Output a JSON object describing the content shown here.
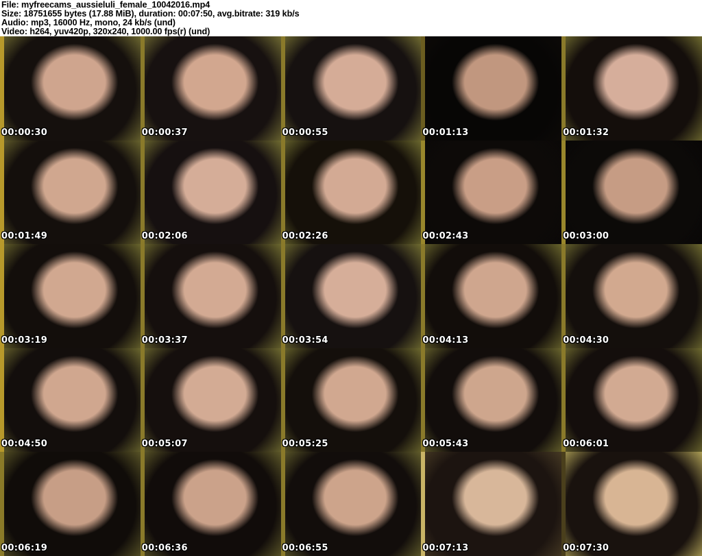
{
  "header": {
    "background": "#ffffff",
    "text_color": "#000000",
    "file_line": "File: myfreecams_aussieluli_female_10042016.mp4",
    "size_line": "Size: 18751655 bytes (17.88 MiB), duration: 00:07:50, avg.bitrate: 319 kb/s",
    "audio_line": "Audio: mp3, 16000 Hz, mono, 24 kb/s (und)",
    "video_line": "Video: h264, yuv420p, 320x240, 1000.00 fps(r) (und)"
  },
  "grid": {
    "columns": 5,
    "rows": 5,
    "timestamp_text_color": "#ffffff",
    "timestamp_outline_color": "#000000",
    "thumbnails": [
      {
        "timestamp": "00:00:30",
        "colors": [
          "#b7992b",
          "#6f6a31",
          "#15100d",
          "#cfa58e"
        ]
      },
      {
        "timestamp": "00:00:37",
        "colors": [
          "#8a7a2a",
          "#716c33",
          "#171110",
          "#d2a78f"
        ]
      },
      {
        "timestamp": "00:00:55",
        "colors": [
          "#8a7a2a",
          "#736e32",
          "#161110",
          "#d5ac97"
        ]
      },
      {
        "timestamp": "00:01:13",
        "colors": [
          "#6b5d20",
          "#0d0a08",
          "#070605",
          "#c1977f"
        ]
      },
      {
        "timestamp": "00:01:32",
        "colors": [
          "#8a7a2a",
          "#716d31",
          "#140e0b",
          "#d6ae9b"
        ]
      },
      {
        "timestamp": "00:01:49",
        "colors": [
          "#b7992b",
          "#6a652e",
          "#140f0c",
          "#d0a78f"
        ]
      },
      {
        "timestamp": "00:02:06",
        "colors": [
          "#8a7a2a",
          "#716d31",
          "#161010",
          "#d5ad98"
        ]
      },
      {
        "timestamp": "00:02:26",
        "colors": [
          "#8a7a2a",
          "#6d6a2f",
          "#151009",
          "#d3aa94"
        ]
      },
      {
        "timestamp": "00:02:43",
        "colors": [
          "#99872c",
          "#0a0807",
          "#0d0a08",
          "#c99e86"
        ]
      },
      {
        "timestamp": "00:03:00",
        "colors": [
          "#99872c",
          "#080606",
          "#0c0a08",
          "#c69c84"
        ]
      },
      {
        "timestamp": "00:03:19",
        "colors": [
          "#b7992b",
          "#6c682e",
          "#130e0b",
          "#d1a890"
        ]
      },
      {
        "timestamp": "00:03:37",
        "colors": [
          "#8a7a2a",
          "#6f6b30",
          "#150f0d",
          "#d3aa93"
        ]
      },
      {
        "timestamp": "00:03:54",
        "colors": [
          "#8a7a2a",
          "#716d31",
          "#161110",
          "#d6ae99"
        ]
      },
      {
        "timestamp": "00:04:13",
        "colors": [
          "#8a7a2a",
          "#6b672d",
          "#120d0a",
          "#cfa68e"
        ]
      },
      {
        "timestamp": "00:04:30",
        "colors": [
          "#8a7a2a",
          "#6e6a30",
          "#140f0c",
          "#d2a98f"
        ]
      },
      {
        "timestamp": "00:04:50",
        "colors": [
          "#b7992b",
          "#6d692f",
          "#130e0c",
          "#d0a78f"
        ]
      },
      {
        "timestamp": "00:05:07",
        "colors": [
          "#8a7a2a",
          "#706c31",
          "#150f0d",
          "#d3ab94"
        ]
      },
      {
        "timestamp": "00:05:25",
        "colors": [
          "#8a7a2a",
          "#6e6a2f",
          "#140f0b",
          "#d1a890"
        ]
      },
      {
        "timestamp": "00:05:43",
        "colors": [
          "#8a7a2a",
          "#6b672e",
          "#120d0b",
          "#cea68d"
        ]
      },
      {
        "timestamp": "00:06:01",
        "colors": [
          "#8a7a2a",
          "#6f6b30",
          "#140e0c",
          "#d2aa92"
        ]
      },
      {
        "timestamp": "00:06:19",
        "colors": [
          "#8a7a28",
          "#5a5527",
          "#100c09",
          "#c79e86"
        ]
      },
      {
        "timestamp": "00:06:36",
        "colors": [
          "#8a7a2a",
          "#605b2a",
          "#110c0a",
          "#cba28a"
        ]
      },
      {
        "timestamp": "00:06:55",
        "colors": [
          "#8a7a2a",
          "#635f2c",
          "#120d0b",
          "#cda48b"
        ]
      },
      {
        "timestamp": "00:07:13",
        "colors": [
          "#c9b466",
          "#473a24",
          "#1c1410",
          "#d8b79a"
        ]
      },
      {
        "timestamp": "00:07:30",
        "colors": [
          "#4a3f1c",
          "#b0a257",
          "#19120e",
          "#d8b594"
        ]
      }
    ]
  }
}
